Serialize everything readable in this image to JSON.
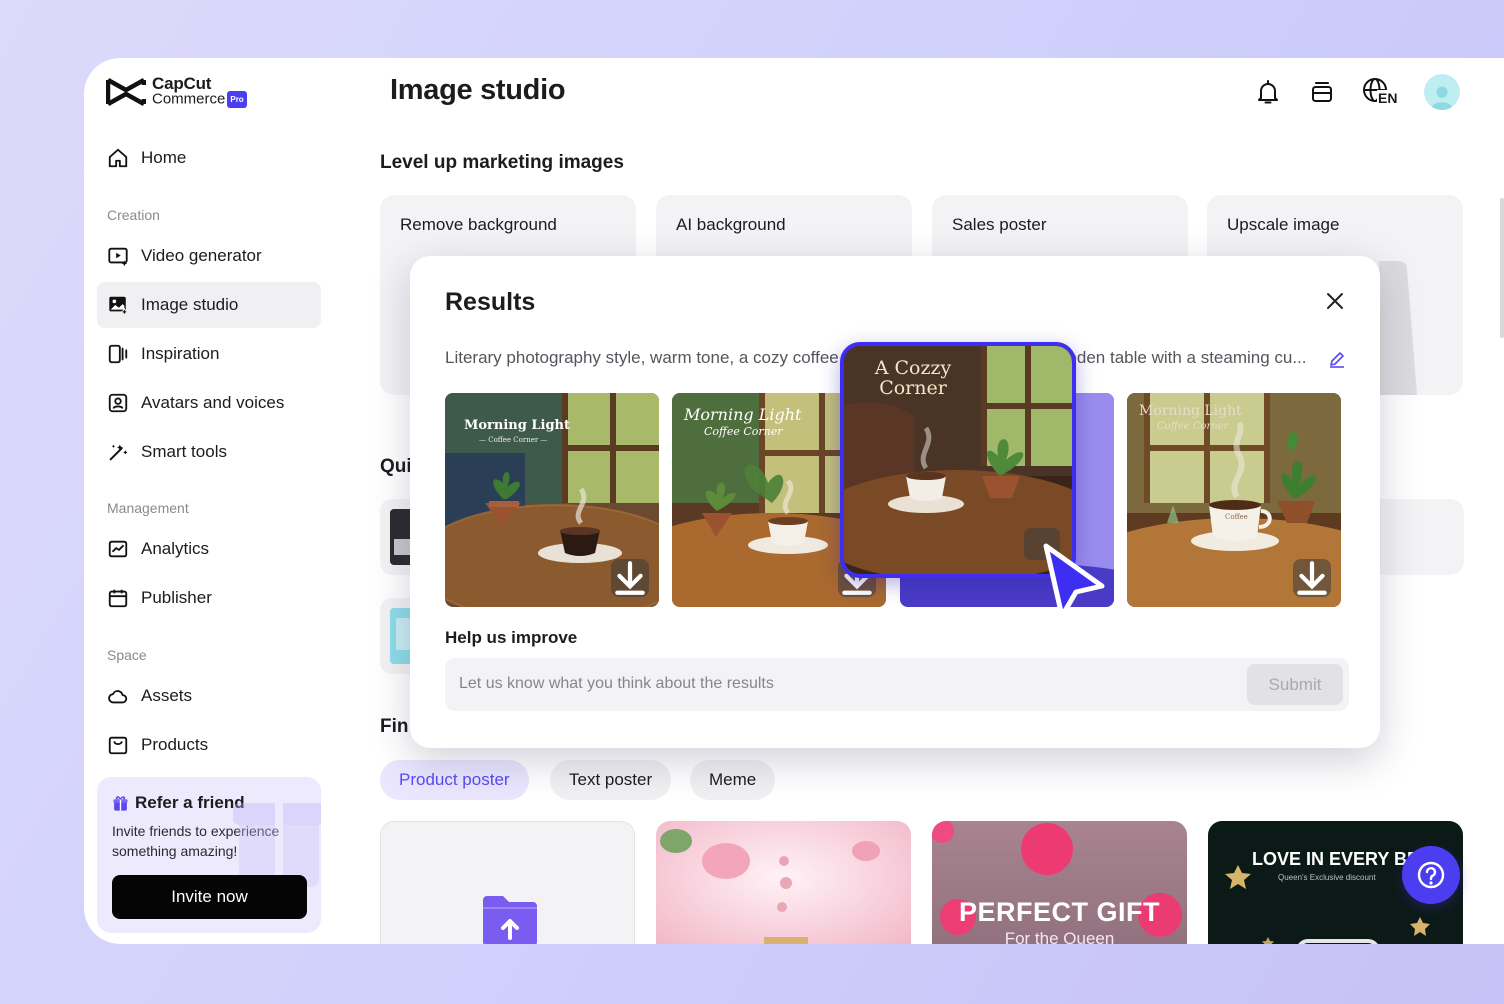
{
  "brand": {
    "name_line1": "CapCut",
    "name_line2": "Commerce",
    "badge": "Pro"
  },
  "header": {
    "title": "Image studio"
  },
  "sidebar": {
    "home": "Home",
    "sections": {
      "creation": "Creation",
      "management": "Management",
      "space": "Space"
    },
    "creation_items": [
      "Video generator",
      "Image studio",
      "Inspiration",
      "Avatars and voices",
      "Smart tools"
    ],
    "management_items": [
      "Analytics",
      "Publisher"
    ],
    "space_items": [
      "Assets",
      "Products"
    ],
    "active_item": "Image studio"
  },
  "refer": {
    "title": "Refer a friend",
    "description": "Invite friends to experience something amazing!",
    "button": "Invite now"
  },
  "main": {
    "section_title": "Level up marketing images",
    "tools": [
      "Remove background",
      "AI background",
      "Sales poster",
      "Upscale image"
    ],
    "quick_partial": "Qui",
    "find_partial": "Fin",
    "template_tabs": [
      "Product poster",
      "Text poster",
      "Meme"
    ],
    "active_tab": "Product poster",
    "templates": {
      "t3_title": "PERFECT GIFT",
      "t3_sub": "For the Queen",
      "t4_title": "LOVE IN EVERY BEA",
      "t4_sub": "Queen's Exclusive discount"
    }
  },
  "modal": {
    "title": "Results",
    "prompt": "Literary photography style, warm tone, a cozy coffee corner, a potted plant on a wooden table with a steaming cu...",
    "images": [
      {
        "title": "Morning Light",
        "subtitle": "— Coffee Corner —"
      },
      {
        "title": "Morning Light",
        "subtitle": "Coffee Corner"
      },
      {
        "title": "A Cozzy Corner",
        "subtitle": ""
      },
      {
        "title": "Morning Light",
        "subtitle": "Coffee Corner",
        "cup_label": "Coffee"
      }
    ],
    "help_title": "Help us improve",
    "feedback_placeholder": "Let us know what you think about the results",
    "submit": "Submit"
  },
  "top_icons": [
    "bell-icon",
    "layers-icon",
    "globe-icon",
    "avatar"
  ],
  "language": "EN",
  "colors": {
    "accent": "#4b3ef0",
    "highlight_border": "#3d2ef2",
    "active_tab_text": "#5a4af4"
  }
}
